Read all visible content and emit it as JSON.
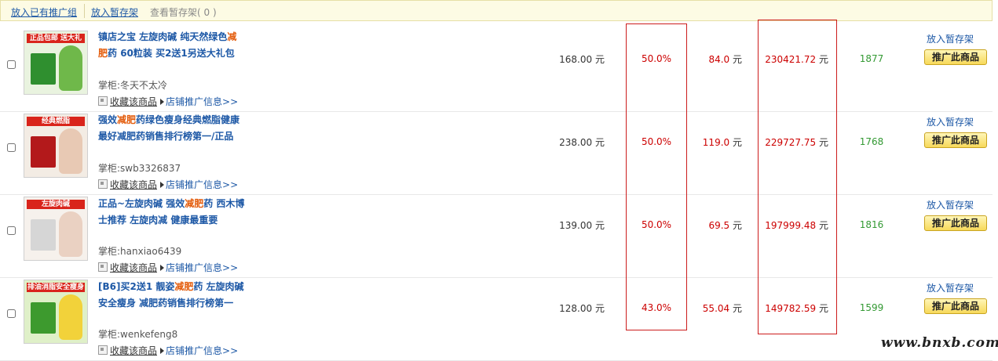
{
  "toolbar": {
    "add_to_group": "放入已有推广组",
    "add_to_stash": "放入暂存架",
    "view_stash": "查看暂存架( 0 )"
  },
  "labels": {
    "seller_label": "掌柜:",
    "favorite": "收藏该商品",
    "shop_info": "店铺推广信息>>",
    "stash": "放入暂存架",
    "promote": "推广此商品",
    "unit": "元"
  },
  "products": [
    {
      "title_pre": "镇店之宝 左旋肉碱 纯天然绿色",
      "title_hl": "减肥",
      "title_post": "药 60粒装 买2送1另送大礼包",
      "seller": "冬天不太冷",
      "price": "168.00",
      "rate": "50.0%",
      "commission": "84.0",
      "sales_total": "230421.72",
      "volume": "1877",
      "thumb_tag": "正品包邮 送大礼包",
      "colors": {
        "bg": "#e9f3df",
        "box": "#2f8f2f",
        "person": "#6fb84a"
      }
    },
    {
      "title_pre": "强效",
      "title_hl": "减肥",
      "title_post": "药绿色瘦身经典燃脂健康最好减肥药销售排行榜第一/正品",
      "seller": "swb3326837",
      "price": "238.00",
      "rate": "50.0%",
      "commission": "119.0",
      "sales_total": "229727.75",
      "volume": "1768",
      "thumb_tag": "经典燃脂",
      "colors": {
        "bg": "#f3ece4",
        "box": "#b3191b",
        "person": "#e8c9b4"
      }
    },
    {
      "title_pre": "正品~左旋肉碱 强效",
      "title_hl": "减肥",
      "title_post": "药 西木博士推荐 左旋肉减 健康最重要",
      "seller": "hanxiao6439",
      "price": "139.00",
      "rate": "50.0%",
      "commission": "69.5",
      "sales_total": "197999.48",
      "volume": "1816",
      "thumb_tag": "左旋肉碱",
      "colors": {
        "bg": "#f6f1ec",
        "box": "#d6d6d6",
        "person": "#ead1c2"
      }
    },
    {
      "title_pre": "[B6]买2送1 靓姿",
      "title_hl": "减肥",
      "title_post": "药 左旋肉碱安全瘦身 减肥药销售排行榜第一",
      "seller": "wenkefeng8",
      "price": "128.00",
      "rate": "43.0%",
      "commission": "55.04",
      "sales_total": "149782.59",
      "volume": "1599",
      "thumb_tag": "排油消脂安全瘦身",
      "colors": {
        "bg": "#dff0c8",
        "box": "#3d9a2e",
        "person": "#f2d23a"
      }
    }
  ],
  "watermark": "www.bnxb.com"
}
